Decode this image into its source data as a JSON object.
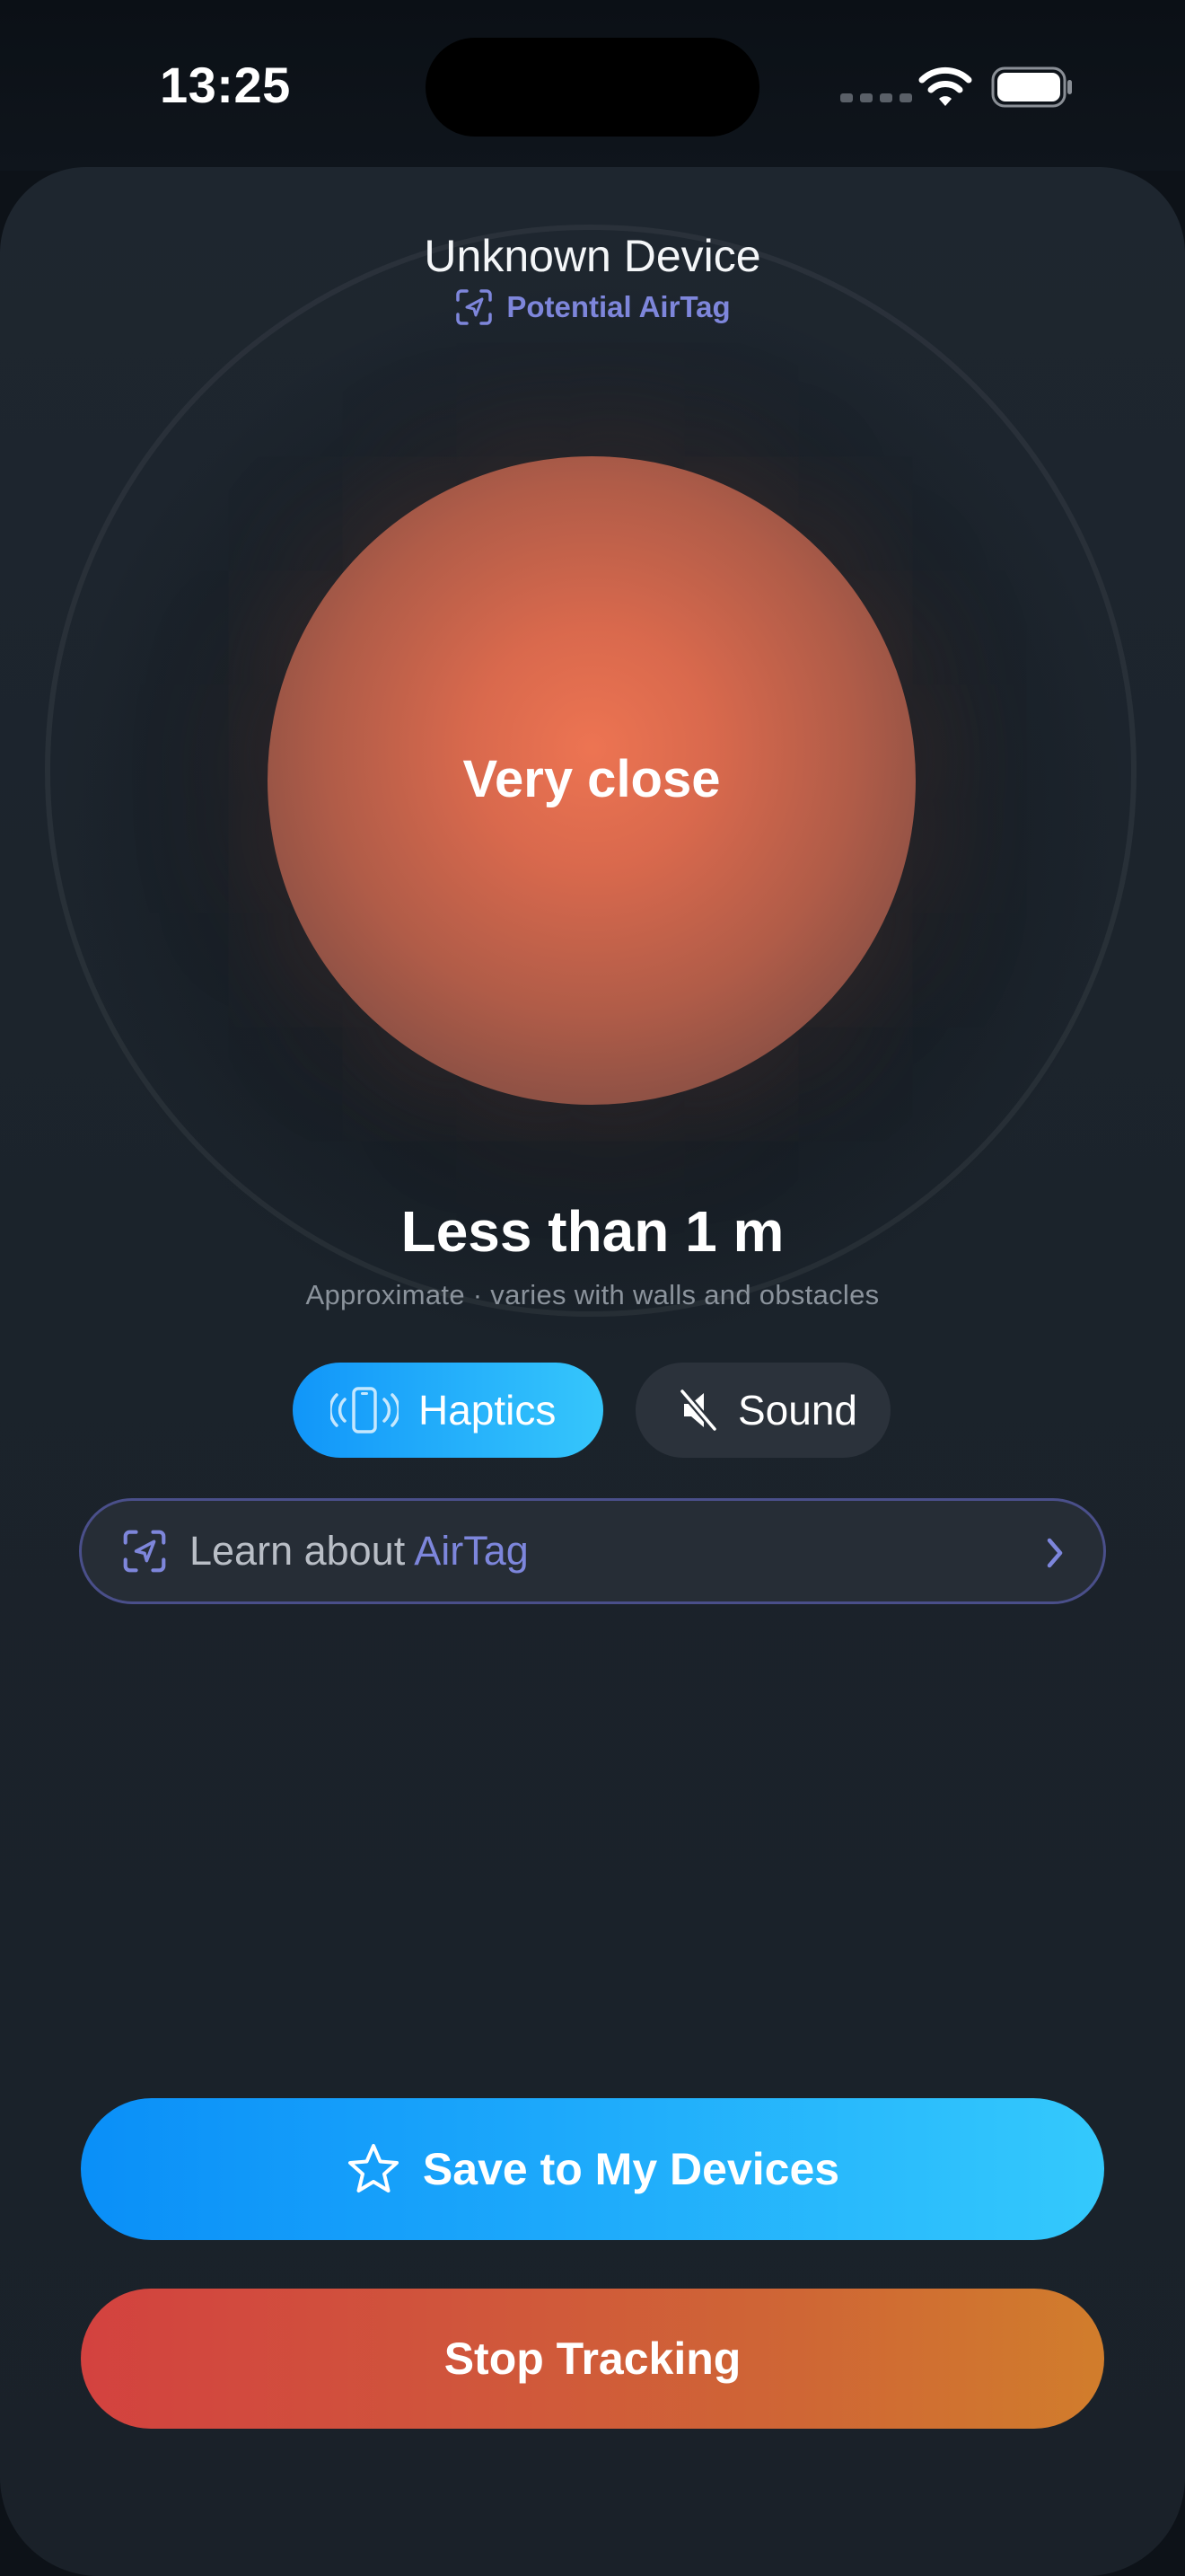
{
  "status_bar": {
    "time": "13:25",
    "wifi_icon": "wifi-icon",
    "battery_icon": "battery-icon"
  },
  "device": {
    "title": "Unknown Device",
    "subtitle": "Potential AirTag",
    "subtitle_icon": "airtag-scan-icon"
  },
  "proximity": {
    "label": "Very close",
    "distance": "Less than 1 m",
    "note": "Approximate · varies with walls and obstacles"
  },
  "toggles": {
    "haptics": {
      "label": "Haptics",
      "icon": "phone-vibrate-icon",
      "active": true
    },
    "sound": {
      "label": "Sound",
      "icon": "speaker-muted-icon",
      "active": false
    }
  },
  "learn": {
    "prefix": "Learn about ",
    "accent": "AirTag",
    "icon": "airtag-scan-icon",
    "chevron": "chevron-right-icon"
  },
  "actions": {
    "save_label": "Save to My Devices",
    "save_icon": "star-icon",
    "stop_label": "Stop Tracking"
  },
  "colors": {
    "accent_blue": "#1ca8fb",
    "accent_indigo": "#7e86db",
    "orb": "#ed7452",
    "stop_start": "#d3423f",
    "stop_end": "#d17d2c",
    "background": "#1b232b"
  }
}
